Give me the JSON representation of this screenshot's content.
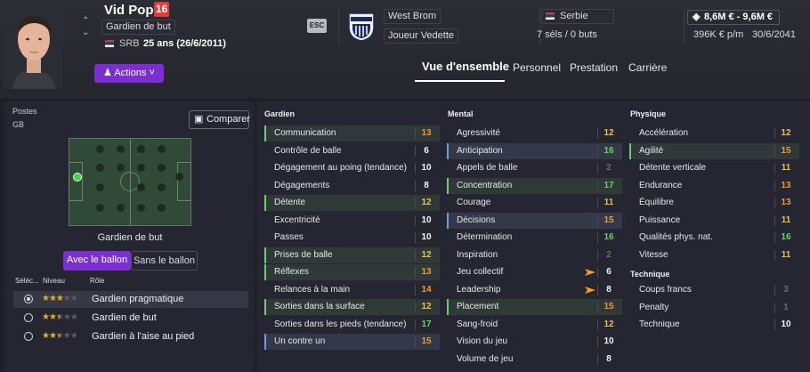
{
  "player": {
    "name": "Vid Popin",
    "number": "16",
    "position": "Gardien de but",
    "nationality_code": "SRB",
    "age_birth": "25 ans (26/6/2011)",
    "actions_label": "Actions"
  },
  "club": {
    "esc_label": "ESC",
    "name": "West Brom",
    "status": "Joueur Vedette"
  },
  "nation": {
    "name": "Serbie",
    "caps": "7 séls / 0 buts"
  },
  "contract": {
    "value": "8,6M € - 9,6M €",
    "wage": "396K € p/m",
    "expiry": "30/6/2041"
  },
  "tabs": [
    {
      "label": "Vue d'ensemble",
      "active": true
    },
    {
      "label": "Personnel",
      "active": false
    },
    {
      "label": "Prestation",
      "active": false
    },
    {
      "label": "Carrière",
      "active": false
    }
  ],
  "left": {
    "postes_label": "Postes",
    "postes_value": "GB",
    "compare_label": "Comparer",
    "pitch_title": "Gardien de but",
    "toggle_with": "Avec le ballon",
    "toggle_without": "Sans le ballon",
    "role_headers": [
      "Séléc...",
      "Niveau",
      "Rôle"
    ],
    "roles": [
      {
        "name": "Gardien pragmatique",
        "stars": 3,
        "selected": true
      },
      {
        "name": "Gardien de but",
        "stars": 2.5,
        "selected": false
      },
      {
        "name": "Gardien à l'aise au pied",
        "stars": 2.5,
        "selected": false
      }
    ]
  },
  "attributes": {
    "gardien_title": "Gardien",
    "gardien": [
      {
        "name": "Communication",
        "value": "13",
        "color": "orange",
        "hl": "hl",
        "mark": "green"
      },
      {
        "name": "Contrôle de balle",
        "value": "6",
        "color": "white",
        "hl": "",
        "mark": ""
      },
      {
        "name": "Dégagement au poing (tendance)",
        "value": "10",
        "color": "white",
        "hl": "",
        "mark": ""
      },
      {
        "name": "Dégagements",
        "value": "8",
        "color": "white",
        "hl": "",
        "mark": ""
      },
      {
        "name": "Détente",
        "value": "12",
        "color": "yellow",
        "hl": "hl",
        "mark": "green"
      },
      {
        "name": "Excentricité",
        "value": "10",
        "color": "white",
        "hl": "",
        "mark": ""
      },
      {
        "name": "Passes",
        "value": "10",
        "color": "white",
        "hl": "",
        "mark": ""
      },
      {
        "name": "Prises de balle",
        "value": "12",
        "color": "yellow",
        "hl": "hl",
        "mark": "green"
      },
      {
        "name": "Réflexes",
        "value": "13",
        "color": "orange",
        "hl": "hl",
        "mark": "green"
      },
      {
        "name": "Relances à la main",
        "value": "14",
        "color": "orange",
        "hl": "",
        "mark": ""
      },
      {
        "name": "Sorties dans la surface",
        "value": "12",
        "color": "yellow",
        "hl": "hl",
        "mark": "green"
      },
      {
        "name": "Sorties dans les pieds (tendance)",
        "value": "17",
        "color": "green",
        "hl": "",
        "mark": ""
      },
      {
        "name": "Un contre un",
        "value": "15",
        "color": "orange",
        "hl": "hlb",
        "mark": "blue"
      }
    ],
    "mental_title": "Mental",
    "mental": [
      {
        "name": "Agressivité",
        "value": "12",
        "color": "yellow",
        "hl": "",
        "mark": ""
      },
      {
        "name": "Anticipation",
        "value": "16",
        "color": "green",
        "hl": "hlb",
        "mark": "blue"
      },
      {
        "name": "Appels de balle",
        "value": "2",
        "color": "grey",
        "hl": "",
        "mark": ""
      },
      {
        "name": "Concentration",
        "value": "17",
        "color": "green",
        "hl": "hl",
        "mark": "green"
      },
      {
        "name": "Courage",
        "value": "11",
        "color": "yellow",
        "hl": "",
        "mark": ""
      },
      {
        "name": "Décisions",
        "value": "15",
        "color": "orange",
        "hl": "hlb",
        "mark": "blue"
      },
      {
        "name": "Détermination",
        "value": "16",
        "color": "green",
        "hl": "",
        "mark": ""
      },
      {
        "name": "Inspiration",
        "value": "2",
        "color": "grey",
        "hl": "",
        "mark": ""
      },
      {
        "name": "Jeu collectif",
        "value": "6",
        "color": "white",
        "hl": "",
        "mark": "",
        "bolt": true
      },
      {
        "name": "Leadership",
        "value": "8",
        "color": "white",
        "hl": "",
        "mark": "",
        "bolt": true
      },
      {
        "name": "Placement",
        "value": "15",
        "color": "orange",
        "hl": "hl",
        "mark": "green"
      },
      {
        "name": "Sang-froid",
        "value": "12",
        "color": "yellow",
        "hl": "",
        "mark": ""
      },
      {
        "name": "Vision du jeu",
        "value": "10",
        "color": "white",
        "hl": "",
        "mark": ""
      },
      {
        "name": "Volume de jeu",
        "value": "8",
        "color": "white",
        "hl": "",
        "mark": ""
      }
    ],
    "physique_title": "Physique",
    "physique": [
      {
        "name": "Accélération",
        "value": "12",
        "color": "yellow",
        "hl": "",
        "mark": ""
      },
      {
        "name": "Agilité",
        "value": "15",
        "color": "orange",
        "hl": "hl",
        "mark": "green"
      },
      {
        "name": "Détente verticale",
        "value": "11",
        "color": "yellow",
        "hl": "",
        "mark": ""
      },
      {
        "name": "Endurance",
        "value": "13",
        "color": "orange",
        "hl": "",
        "mark": ""
      },
      {
        "name": "Équilibre",
        "value": "13",
        "color": "orange",
        "hl": "",
        "mark": ""
      },
      {
        "name": "Puissance",
        "value": "11",
        "color": "yellow",
        "hl": "",
        "mark": ""
      },
      {
        "name": "Qualités phys. nat.",
        "value": "16",
        "color": "green",
        "hl": "",
        "mark": ""
      },
      {
        "name": "Vitesse",
        "value": "11",
        "color": "yellow",
        "hl": "",
        "mark": ""
      }
    ],
    "technique_title": "Technique",
    "technique": [
      {
        "name": "Coups francs",
        "value": "3",
        "color": "grey",
        "hl": "",
        "mark": ""
      },
      {
        "name": "Penalty",
        "value": "1",
        "color": "grey",
        "hl": "",
        "mark": ""
      },
      {
        "name": "Technique",
        "value": "10",
        "color": "white",
        "hl": "",
        "mark": ""
      }
    ]
  }
}
